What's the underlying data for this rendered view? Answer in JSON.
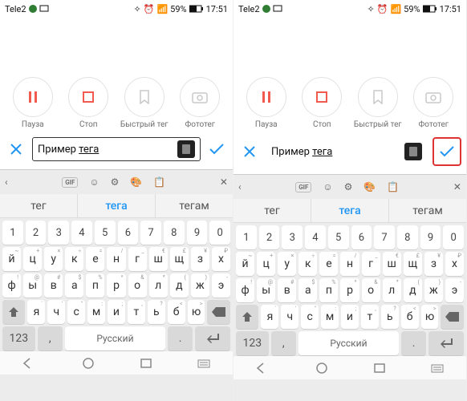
{
  "status": {
    "carrier": "Tele2",
    "battery_pct": "59%",
    "time": "17:51"
  },
  "actions": {
    "pause": "Пауза",
    "stop": "Стоп",
    "quicktag": "Быстрый тег",
    "phototag": "Фототег"
  },
  "tag": {
    "prefix": "Пример ",
    "underlined": "тега"
  },
  "suggestions": {
    "s1": "тег",
    "s2": "тега",
    "s3": "тегам"
  },
  "keyboard": {
    "gif": "GIF",
    "row_num": [
      "1",
      "2",
      "3",
      "4",
      "5",
      "6",
      "7",
      "8",
      "9",
      "0"
    ],
    "row1": [
      "й",
      "ц",
      "у",
      "к",
      "е",
      "н",
      "г",
      "ш",
      "щ",
      "з",
      "х"
    ],
    "row1_subs": [
      "~",
      "+",
      "×",
      "÷",
      "=",
      "/",
      "_",
      "€",
      "£",
      "¥",
      "₽"
    ],
    "row2": [
      "ф",
      "ы",
      "в",
      "а",
      "п",
      "р",
      "о",
      "л",
      "д",
      "ж",
      "э"
    ],
    "row2_subs": [
      "!",
      "@",
      "#",
      "$",
      "%",
      "^",
      "&",
      "*",
      "(",
      ")",
      "-"
    ],
    "row3": [
      "я",
      "ч",
      "с",
      "м",
      "и",
      "т",
      "ь",
      "б",
      "ю"
    ],
    "row3_subs": [
      "`",
      "'",
      "\"",
      ":",
      ";",
      ",",
      "?",
      "<",
      ">"
    ],
    "mode_key": "123",
    "comma": ",",
    "lang": "Русский",
    "period": "."
  },
  "colors": {
    "accent": "#2196f3",
    "pause_red": "#f05a4f",
    "highlight": "#d33"
  }
}
